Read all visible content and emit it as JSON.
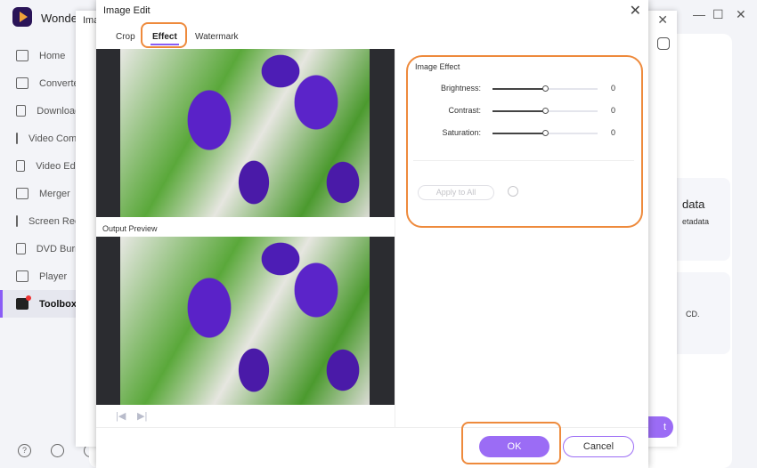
{
  "app": {
    "name": "Wonder",
    "window_controls": [
      "—",
      "☐",
      "✕"
    ]
  },
  "sidebar": {
    "items": [
      {
        "label": "Home",
        "icon": "home-icon"
      },
      {
        "label": "Converter",
        "icon": "converter-icon"
      },
      {
        "label": "Downloader",
        "icon": "download-icon"
      },
      {
        "label": "Video Compressor",
        "icon": "video-compress-icon"
      },
      {
        "label": "Video Editor",
        "icon": "scissors-icon"
      },
      {
        "label": "Merger",
        "icon": "merger-icon"
      },
      {
        "label": "Screen Recorder",
        "icon": "screen-record-icon"
      },
      {
        "label": "DVD Burner",
        "icon": "dvd-icon"
      },
      {
        "label": "Player",
        "icon": "player-icon"
      },
      {
        "label": "Toolbox",
        "icon": "toolbox-icon",
        "active": true
      }
    ],
    "bottom_icons": [
      "help-icon",
      "bell-icon",
      "support-icon"
    ]
  },
  "background_cards": [
    {
      "title": "data",
      "desc": "etadata"
    },
    {
      "desc": "CD."
    }
  ],
  "behind_window": {
    "title": "Ima",
    "start_label": "t"
  },
  "dialog": {
    "title": "Image Edit",
    "tabs": [
      {
        "label": "Crop"
      },
      {
        "label": "Effect",
        "active": true
      },
      {
        "label": "Watermark"
      }
    ],
    "output_preview_label": "Output Preview",
    "effect": {
      "heading": "Image Effect",
      "sliders": [
        {
          "label": "Brightness:",
          "value": "0",
          "level": 0.5
        },
        {
          "label": "Contrast:",
          "value": "0",
          "level": 0.5
        },
        {
          "label": "Saturation:",
          "value": "0",
          "level": 0.5
        }
      ],
      "apply_all": "Apply to All"
    },
    "ok": "OK",
    "cancel": "Cancel"
  },
  "colors": {
    "accent": "#9b6cf5",
    "highlight": "#ee8a3c"
  }
}
